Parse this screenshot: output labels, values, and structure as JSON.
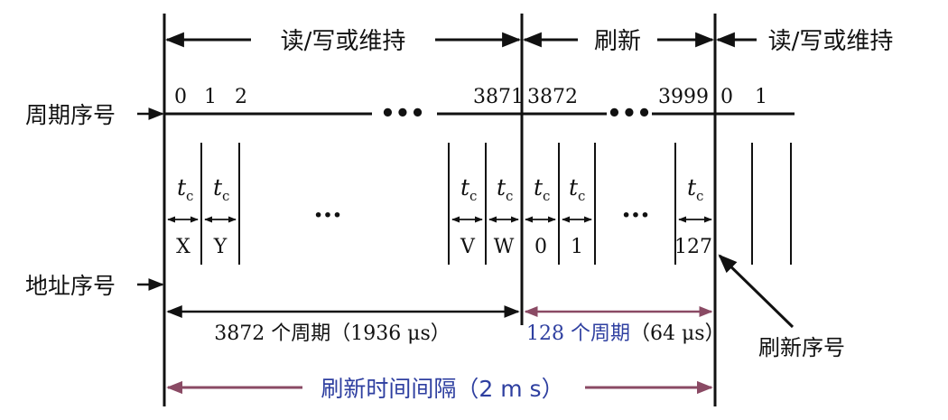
{
  "top": {
    "rw_label_left": "读/写或维持",
    "refresh_label": "刷新",
    "rw_label_right": "读/写或维持"
  },
  "left": {
    "cycle_no_label": "周期序号",
    "addr_no_label": "地址序号"
  },
  "cycle_numbers": [
    "0",
    "1",
    "2",
    "3871",
    "3872",
    "3999",
    "0",
    "1"
  ],
  "dots": "•••",
  "ellipsis": "···",
  "tc": {
    "t": "t",
    "sub": "c"
  },
  "addresses": [
    "X",
    "Y",
    "V",
    "W",
    "0",
    "1",
    "127"
  ],
  "spans": {
    "rw_cycles": "3872 个周期（1936 μs）",
    "refresh_cycles_prefix": "128 个周期",
    "refresh_cycles_suffix": "（64 μs）",
    "interval": "刷新时间间隔（2 m s）"
  },
  "pointer_label": "刷新序号",
  "colors": {
    "ink": "#111111",
    "blue": "#2e3fa0",
    "maroon": "#8a4a64"
  }
}
